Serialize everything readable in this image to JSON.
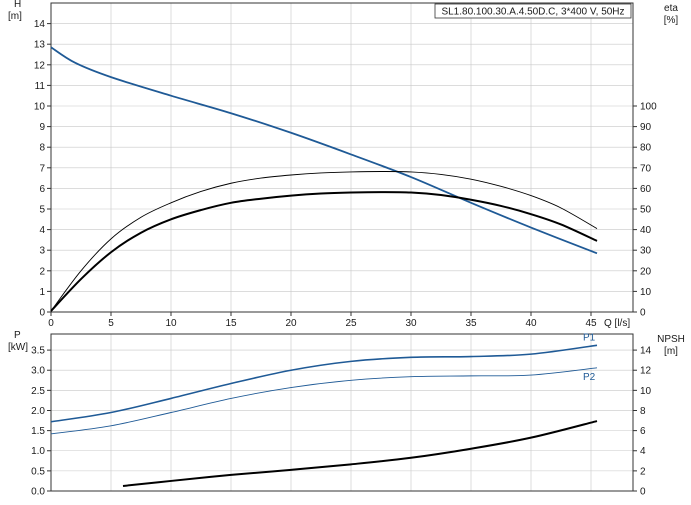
{
  "chart_data": [
    {
      "type": "line",
      "title": "SL1.80.100.30.A.4.50D.C, 3*400 V, 50Hz",
      "xlabel": "Q [l/s]",
      "ylabel_left": [
        "H",
        "[m]"
      ],
      "ylabel_right": [
        "eta",
        "[%]"
      ],
      "xlim": [
        0,
        48.5
      ],
      "ylim": [
        0,
        15
      ],
      "y2lim": [
        0,
        1
      ],
      "xticks": [
        0,
        5,
        10,
        15,
        20,
        25,
        30,
        35,
        40,
        45
      ],
      "yticks": [
        0,
        1,
        2,
        3,
        4,
        5,
        6,
        7,
        8,
        9,
        10,
        11,
        12,
        13,
        14
      ],
      "y2ticks": [
        0,
        10,
        20,
        30,
        40,
        50,
        60,
        70,
        80,
        90,
        100
      ],
      "y2tick_positions": [
        0,
        1,
        2,
        3,
        4,
        5,
        6,
        7,
        8,
        9,
        10
      ],
      "grid": true,
      "series": [
        {
          "axis": "left",
          "color": "#1f5a96",
          "width": 1.8,
          "x": [
            0,
            2,
            5,
            10,
            15,
            20,
            25,
            30,
            35,
            40,
            45.5
          ],
          "y": [
            12.85,
            12.1,
            11.4,
            10.5,
            9.65,
            8.7,
            7.65,
            6.55,
            5.3,
            4.1,
            2.85
          ]
        },
        {
          "axis": "left",
          "color": "#000000",
          "width": 0.9,
          "x": [
            0,
            2.5,
            5,
            7.5,
            10,
            12.5,
            15,
            17.5,
            20,
            22.5,
            25,
            27.5,
            30,
            32.5,
            35,
            37.5,
            40,
            42.5,
            45.5
          ],
          "y": [
            0.05,
            2.0,
            3.55,
            4.6,
            5.3,
            5.85,
            6.25,
            6.5,
            6.65,
            6.75,
            6.8,
            6.82,
            6.8,
            6.68,
            6.45,
            6.1,
            5.65,
            5.05,
            4.05
          ]
        },
        {
          "axis": "left",
          "color": "#000000",
          "width": 2,
          "x": [
            0,
            2.5,
            5,
            7.5,
            10,
            12.5,
            15,
            17.5,
            20,
            22.5,
            25,
            27.5,
            30,
            32.5,
            35,
            37.5,
            40,
            42.5,
            45.5
          ],
          "y": [
            0.05,
            1.6,
            2.9,
            3.85,
            4.5,
            4.95,
            5.3,
            5.5,
            5.65,
            5.75,
            5.8,
            5.82,
            5.8,
            5.68,
            5.45,
            5.15,
            4.75,
            4.25,
            3.45
          ]
        }
      ]
    },
    {
      "type": "line",
      "ylabel_left": [
        "P",
        "[kW]"
      ],
      "ylabel_right": [
        "NPSH",
        "[m]"
      ],
      "xlim": [
        0,
        48.5
      ],
      "ylim": [
        0,
        3.9
      ],
      "y2lim": [
        0,
        15.6
      ],
      "yticks": [
        0.0,
        0.5,
        1.0,
        1.5,
        2.0,
        2.5,
        3.0,
        3.5
      ],
      "ytick_labels": [
        "0.0",
        "0.5",
        "1.0",
        "1.5",
        "2.0",
        "2.5",
        "3.0",
        "3.5"
      ],
      "y2ticks": [
        0,
        2,
        4,
        6,
        8,
        10,
        12,
        14
      ],
      "grid": true,
      "series": [
        {
          "name": "P1",
          "axis": "left",
          "color": "#1f5a96",
          "width": 1.6,
          "x": [
            0,
            5,
            10,
            15,
            20,
            25,
            30,
            35,
            40,
            45.5
          ],
          "y": [
            1.72,
            1.95,
            2.3,
            2.67,
            3.0,
            3.22,
            3.32,
            3.34,
            3.4,
            3.62
          ]
        },
        {
          "name": "P2",
          "axis": "left",
          "color": "#1f5a96",
          "width": 0.9,
          "x": [
            0,
            5,
            10,
            15,
            20,
            25,
            30,
            35,
            40,
            45.5
          ],
          "y": [
            1.42,
            1.62,
            1.95,
            2.3,
            2.57,
            2.75,
            2.84,
            2.86,
            2.88,
            3.06
          ]
        },
        {
          "axis": "right",
          "color": "#000000",
          "width": 2,
          "x": [
            6,
            10,
            15,
            20,
            25,
            30,
            35,
            40,
            45.5
          ],
          "y": [
            0.5,
            1.0,
            1.6,
            2.1,
            2.65,
            3.3,
            4.2,
            5.3,
            6.95
          ]
        }
      ]
    }
  ]
}
